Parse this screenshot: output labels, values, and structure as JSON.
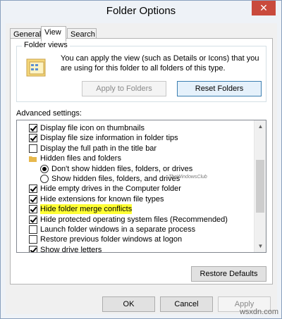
{
  "window": {
    "title": "Folder Options",
    "close_glyph": "✕"
  },
  "tabs": [
    {
      "label": "General",
      "active": false
    },
    {
      "label": "View",
      "active": true
    },
    {
      "label": "Search",
      "active": false
    }
  ],
  "folder_views": {
    "label": "Folder views",
    "description": "You can apply the view (such as Details or Icons) that you are using for this folder to all folders of this type.",
    "apply_button": "Apply to Folders",
    "reset_button": "Reset Folders",
    "icon": "folder-views-icon"
  },
  "advanced": {
    "label": "Advanced settings:",
    "items": [
      {
        "type": "checkbox",
        "checked": true,
        "indent": 0,
        "label": "Display file icon on thumbnails"
      },
      {
        "type": "checkbox",
        "checked": true,
        "indent": 0,
        "label": "Display file size information in folder tips"
      },
      {
        "type": "checkbox",
        "checked": false,
        "indent": 0,
        "label": "Display the full path in the title bar"
      },
      {
        "type": "folder",
        "indent": 0,
        "label": "Hidden files and folders"
      },
      {
        "type": "radio",
        "checked": true,
        "indent": 1,
        "label": "Don't show hidden files, folders, or drives"
      },
      {
        "type": "radio",
        "checked": false,
        "indent": 1,
        "label": "Show hidden files, folders, and drives"
      },
      {
        "type": "checkbox",
        "checked": true,
        "indent": 0,
        "label": "Hide empty drives in the Computer folder"
      },
      {
        "type": "checkbox",
        "checked": true,
        "indent": 0,
        "label": "Hide extensions for known file types"
      },
      {
        "type": "checkbox",
        "checked": true,
        "indent": 0,
        "label": "Hide folder merge conflicts",
        "highlight": true
      },
      {
        "type": "checkbox",
        "checked": true,
        "indent": 0,
        "label": "Hide protected operating system files (Recommended)"
      },
      {
        "type": "checkbox",
        "checked": false,
        "indent": 0,
        "label": "Launch folder windows in a separate process"
      },
      {
        "type": "checkbox",
        "checked": false,
        "indent": 0,
        "label": "Restore previous folder windows at logon"
      },
      {
        "type": "checkbox",
        "checked": true,
        "indent": 0,
        "label": "Show drive letters"
      }
    ],
    "watermark": "TheWindowsClub",
    "highlight_color": "#ffff33"
  },
  "buttons": {
    "restore_defaults": "Restore Defaults",
    "ok": "OK",
    "cancel": "Cancel",
    "apply": "Apply"
  },
  "footer_watermark": "wsxdn.com"
}
